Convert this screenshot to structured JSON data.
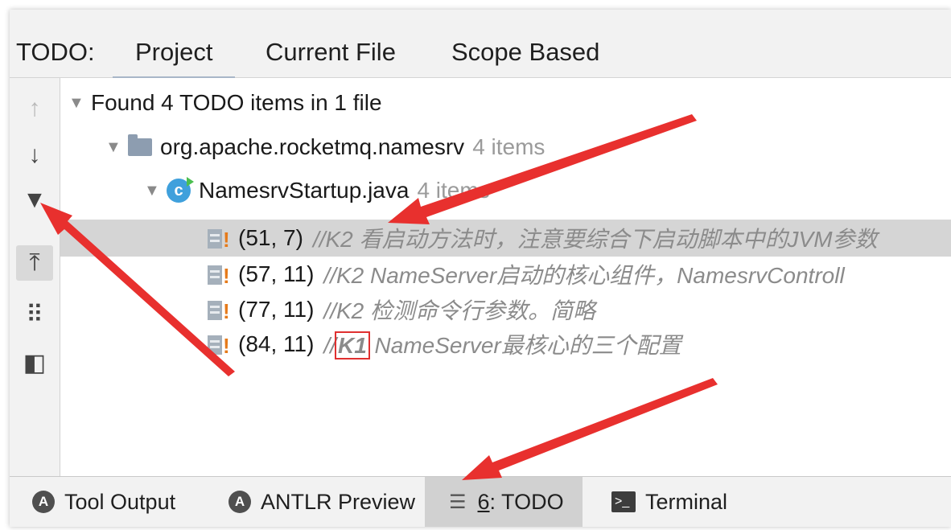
{
  "tabbar": {
    "label": "TODO:",
    "tabs": [
      {
        "label": "Project",
        "active": true
      },
      {
        "label": "Current File",
        "active": false
      },
      {
        "label": "Scope Based",
        "active": false
      }
    ]
  },
  "toolstrip": {
    "items": [
      {
        "name": "arrow-up-icon",
        "glyph": "↑",
        "state": "disabled"
      },
      {
        "name": "arrow-down-icon",
        "glyph": "↓",
        "state": "normal"
      },
      {
        "name": "expand-triangle-icon",
        "glyph": "▼",
        "state": "normal"
      },
      {
        "name": "autoscroll-icon",
        "glyph": "⤒",
        "state": "pressed"
      },
      {
        "name": "group-by-icon",
        "glyph": "⠿",
        "state": "normal"
      },
      {
        "name": "preview-panel-icon",
        "glyph": "◧",
        "state": "normal"
      }
    ]
  },
  "tree": {
    "summary": "Found 4 TODO items in 1 file",
    "package": {
      "name": "org.apache.rocketmq.namesrv",
      "count": "4 items"
    },
    "file": {
      "name": "NamesrvStartup.java",
      "count": "4 items",
      "icon_letter": "c"
    },
    "items": [
      {
        "position": "(51, 7)",
        "comment": "//K2 看启动方法时，注意要综合下启动脚本中的JVM参数",
        "selected": true
      },
      {
        "position": "(57, 11)",
        "comment": "//K2 NameServer启动的核心组件，NamesrvControll",
        "selected": false
      },
      {
        "position": "(77, 11)",
        "comment": "//K2 检测命令行参数。简略",
        "selected": false
      },
      {
        "position": "(84, 11)",
        "comment_prefix": "//",
        "comment_tag": "K1",
        "comment_rest": " NameServer最核心的三个配置",
        "selected": false
      }
    ]
  },
  "bottombar": {
    "tabs": [
      {
        "label": "Tool Output",
        "icon": "tool-output-icon",
        "icon_glyph": "A"
      },
      {
        "label": "ANTLR Preview",
        "icon": "antlr-icon",
        "icon_glyph": "A"
      },
      {
        "label_num": "6",
        "label_rest": ": TODO",
        "icon": "list-icon",
        "icon_glyph": "☰",
        "active": true
      },
      {
        "label": "Terminal",
        "icon": "terminal-icon",
        "icon_glyph": ">_"
      }
    ]
  },
  "colors": {
    "selection": "#d5d5d5",
    "comment": "#8b8b8b",
    "annotation_arrow": "#e8302e",
    "todo_marker": "#e57a1a"
  }
}
